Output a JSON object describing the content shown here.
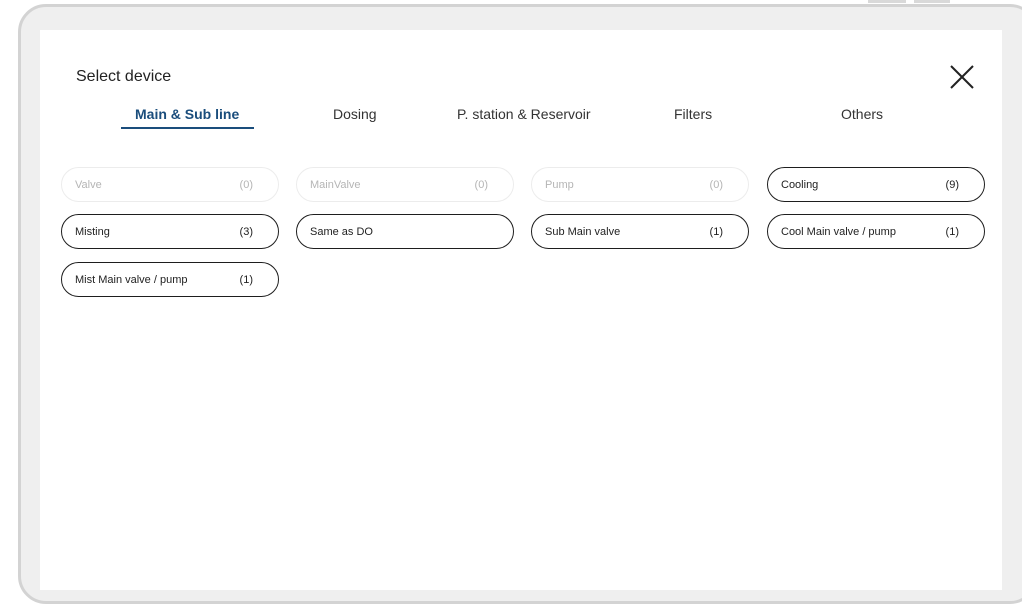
{
  "dialog": {
    "title": "Select device"
  },
  "tabs": [
    {
      "label": "Main & Sub line",
      "active": true
    },
    {
      "label": "Dosing",
      "active": false
    },
    {
      "label": "P. station & Reservoir",
      "active": false
    },
    {
      "label": "Filters",
      "active": false
    },
    {
      "label": "Others",
      "active": false
    }
  ],
  "devices": [
    {
      "label": "Valve",
      "count": "(0)",
      "enabled": false
    },
    {
      "label": "MainValve",
      "count": "(0)",
      "enabled": false
    },
    {
      "label": "Pump",
      "count": "(0)",
      "enabled": false
    },
    {
      "label": "Cooling",
      "count": "(9)",
      "enabled": true
    },
    {
      "label": "Misting",
      "count": "(3)",
      "enabled": true
    },
    {
      "label": "Same as DO",
      "count": "",
      "enabled": true
    },
    {
      "label": "Sub Main valve",
      "count": "(1)",
      "enabled": true
    },
    {
      "label": "Cool Main valve / pump",
      "count": "(1)",
      "enabled": true
    },
    {
      "label": "Mist Main valve / pump",
      "count": "(1)",
      "enabled": true
    }
  ],
  "colors": {
    "accent": "#1a4d7c",
    "chip_border": "#1e1e1e",
    "chip_disabled_text": "#b5b5b5",
    "frame_bg": "#efefef"
  },
  "icons": {
    "close": "close-icon"
  }
}
